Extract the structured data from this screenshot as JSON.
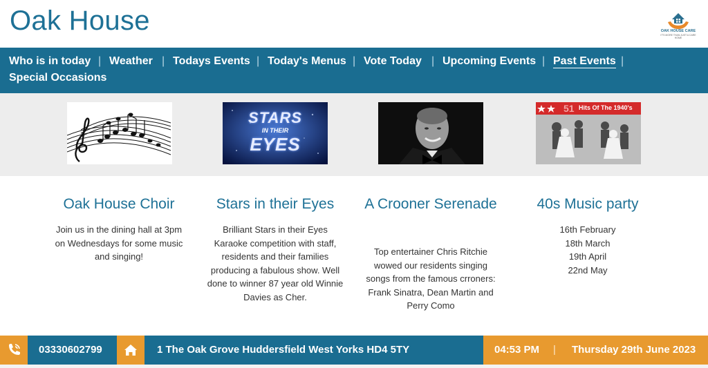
{
  "site": {
    "title": "Oak House",
    "logo_text": "OAK HOUSE CARE",
    "logo_sub": "IT'S MORE THAN JUST A CARE HOME"
  },
  "nav": {
    "items": [
      {
        "label": "Who is in today"
      },
      {
        "label": "Weather"
      },
      {
        "label": "Todays Events"
      },
      {
        "label": "Today's Menus"
      },
      {
        "label": "Vote Today"
      },
      {
        "label": "Upcoming Events"
      },
      {
        "label": "Past Events"
      },
      {
        "label": "Special Occasions"
      }
    ],
    "separator": "|",
    "active": "Past Events"
  },
  "thumbnails": {
    "stars_text_1": "STARS",
    "stars_text_2": "IN THEIR",
    "stars_text_3": "EYES",
    "hits_text": "Hits Of The 1940's",
    "hits_num": "51"
  },
  "cards": [
    {
      "title": "Oak House Choir",
      "body": "Join us in the dining hall at 3pm on Wednesdays for some music and singing!"
    },
    {
      "title": "Stars in their Eyes",
      "body": "Brilliant Stars in their Eyes Karaoke competition with staff, residents and their families producing a fabulous show. Well done to winner 87 year old Winnie Davies as Cher."
    },
    {
      "title": "A Crooner Serenade",
      "body": "Top entertainer Chris Ritchie wowed our residents singing songs from the famous crroners: Frank Sinatra, Dean Martin and Perry Como"
    },
    {
      "title": "40s Music party",
      "dates": [
        "16th February",
        "18th March",
        "19th April",
        "22nd May"
      ]
    }
  ],
  "footer": {
    "phone": "03330602799",
    "address": "1 The Oak Grove Huddersfield West Yorks HD4 5TY",
    "time": "04:53 PM",
    "separator": "|",
    "date": "Thursday 29th June 2023"
  },
  "colors": {
    "brand_blue": "#1a6d91",
    "title_blue": "#1e7196",
    "orange": "#e89a2f"
  }
}
